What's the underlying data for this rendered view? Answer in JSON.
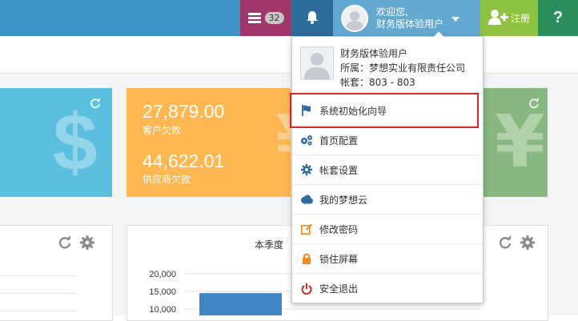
{
  "topbar": {
    "tasks_badge": "32",
    "welcome_line1": "欢迎您,",
    "welcome_line2": "财务版体验用户",
    "register_label": "注册",
    "help_label": "?"
  },
  "tiles": {
    "orange": {
      "receivable_value": "27,879.00",
      "receivable_label": "客户欠款",
      "payable_value": "44,622.01",
      "payable_label": "供应商欠款"
    }
  },
  "chart_panel": {
    "title_partial": "本季度"
  },
  "chart_data": {
    "type": "bar",
    "title": "本季度",
    "y_ticks": [
      "20,000",
      "15,000",
      "10,000"
    ],
    "categories": [
      ""
    ],
    "values": [
      14500
    ],
    "ylim": [
      0,
      20000
    ]
  },
  "user_menu": {
    "user_name": "财务版体验用户",
    "company_line": "所属：梦想实业有限责任公司",
    "account_line": "帐套：803 - 803",
    "items": [
      {
        "label": "系统初始化向导",
        "icon": "flag-icon"
      },
      {
        "label": "首页配置",
        "icon": "cogs-icon"
      },
      {
        "label": "帐套设置",
        "icon": "gear-icon"
      },
      {
        "label": "我的梦想云",
        "icon": "cloud-icon"
      },
      {
        "label": "修改密码",
        "icon": "edit-icon"
      },
      {
        "label": "锁住屏幕",
        "icon": "lock-icon"
      },
      {
        "label": "安全退出",
        "icon": "power-icon"
      }
    ]
  },
  "colors": {
    "topbar": "#3e93c8",
    "tile_blue": "#5bc0de",
    "tile_orange": "#ffb752",
    "tile_green": "#87b87f",
    "tasks_bg": "#a0366a",
    "notif_bg": "#2e6d99",
    "user_bg": "#62a8d1",
    "register_bg": "#8fc23f",
    "help_bg": "#2a8f5c",
    "highlight": "#d9262b"
  }
}
